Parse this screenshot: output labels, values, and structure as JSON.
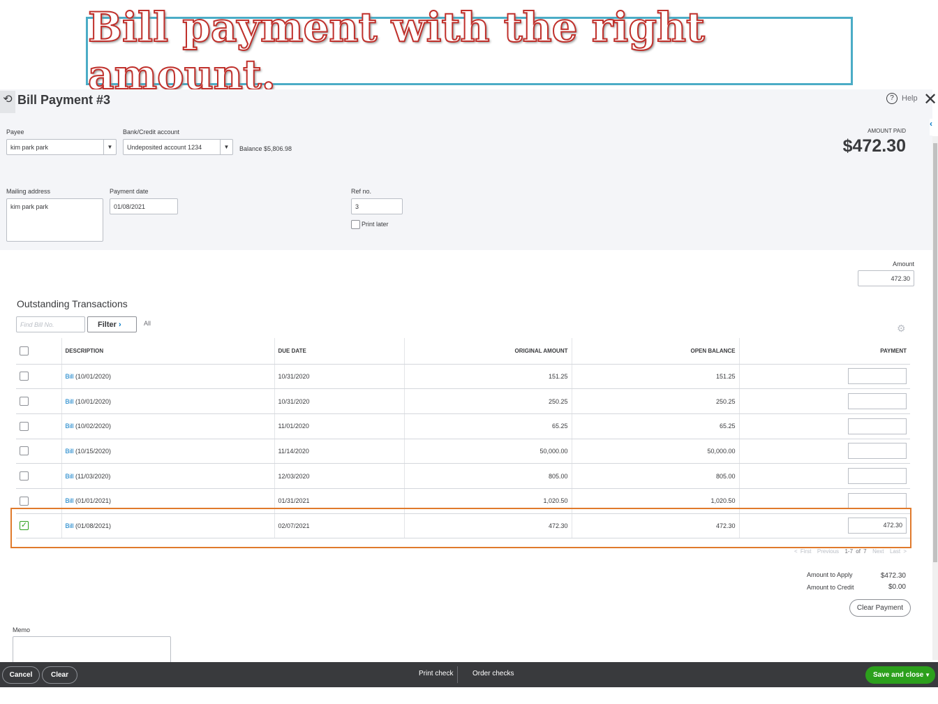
{
  "banner": "Bill payment with the right amount.",
  "header": {
    "title": "Bill Payment #3",
    "help": "Help"
  },
  "form": {
    "payee_label": "Payee",
    "payee": "kim park park",
    "bank_label": "Bank/Credit account",
    "bank": "Undeposited account 1234",
    "balance": "Balance $5,806.98",
    "amount_paid_label": "AMOUNT PAID",
    "amount_paid": "$472.30",
    "mailing_label": "Mailing address",
    "mailing": "kim park park",
    "date_label": "Payment date",
    "date": "01/08/2021",
    "ref_label": "Ref no.",
    "ref": "3",
    "print_later": "Print later",
    "amount_label": "Amount",
    "amount": "472.30"
  },
  "outstanding": {
    "title": "Outstanding Transactions",
    "find_placeholder": "Find Bill No.",
    "filter": "Filter",
    "all": "All",
    "columns": [
      "DESCRIPTION",
      "DUE DATE",
      "ORIGINAL AMOUNT",
      "OPEN BALANCE",
      "PAYMENT"
    ],
    "rows": [
      {
        "link": "Bill",
        "desc": " (10/01/2020)",
        "due": "10/31/2020",
        "orig": "151.25",
        "open": "151.25",
        "payment": "",
        "checked": false
      },
      {
        "link": "Bill",
        "desc": " (10/01/2020)",
        "due": "10/31/2020",
        "orig": "250.25",
        "open": "250.25",
        "payment": "",
        "checked": false
      },
      {
        "link": "Bill",
        "desc": " (10/02/2020)",
        "due": "11/01/2020",
        "orig": "65.25",
        "open": "65.25",
        "payment": "",
        "checked": false
      },
      {
        "link": "Bill",
        "desc": " (10/15/2020)",
        "due": "11/14/2020",
        "orig": "50,000.00",
        "open": "50,000.00",
        "payment": "",
        "checked": false
      },
      {
        "link": "Bill",
        "desc": " (11/03/2020)",
        "due": "12/03/2020",
        "orig": "805.00",
        "open": "805.00",
        "payment": "",
        "checked": false
      },
      {
        "link": "Bill",
        "desc": " (01/01/2021)",
        "due": "01/31/2021",
        "orig": "1,020.50",
        "open": "1,020.50",
        "payment": "",
        "checked": false
      },
      {
        "link": "Bill",
        "desc": " (01/08/2021)",
        "due": "02/07/2021",
        "orig": "472.30",
        "open": "472.30",
        "payment": "472.30",
        "checked": true
      }
    ],
    "pager": {
      "first": "< First",
      "previous": "Previous",
      "range": "1-7 of 7",
      "next": "Next",
      "last": "Last >"
    }
  },
  "totals": {
    "apply_label": "Amount to Apply",
    "apply": "$472.30",
    "credit_label": "Amount to Credit",
    "credit": "$0.00",
    "clear_payment": "Clear Payment"
  },
  "memo_label": "Memo",
  "footer": {
    "cancel": "Cancel",
    "clear": "Clear",
    "print_check": "Print check",
    "order_checks": "Order checks",
    "save_close": "Save and close"
  }
}
